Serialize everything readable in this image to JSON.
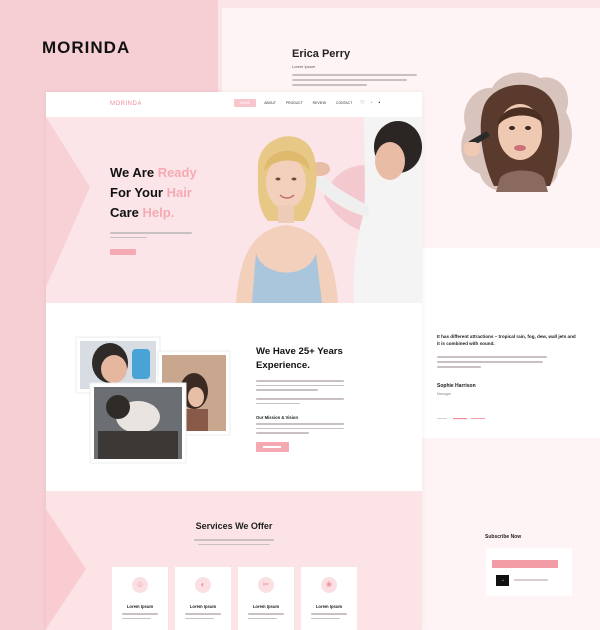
{
  "brand": "MORINDA",
  "nav": {
    "logo": "MORINDA",
    "items": [
      "HOME",
      "ABOUT",
      "PRODUCT",
      "REVIEW",
      "CONTACT"
    ],
    "active_index": 0,
    "icons": [
      "heart-icon",
      "user-icon",
      "cart-icon"
    ]
  },
  "hero": {
    "title_line1_plain": "We Are ",
    "title_line1_hl": "Ready",
    "title_line2_plain": "For Your ",
    "title_line2_hl": "Hair",
    "title_line3_plain": "Care ",
    "title_line3_hl": "Help."
  },
  "about": {
    "title": "We Have 25+ Years Experience.",
    "mission_heading": "Our Mission & Vision"
  },
  "services": {
    "title": "Services We Offer",
    "cards": [
      {
        "title": "Lorem Ipsum",
        "icon": "face-icon"
      },
      {
        "title": "Lorem Ipsum",
        "icon": "hairdryer-icon"
      },
      {
        "title": "Lorem Ipsum",
        "icon": "scissors-icon"
      },
      {
        "title": "Lorem Ipsum",
        "icon": "hair-icon"
      }
    ]
  },
  "testimonial_top": {
    "name": "Erica Perry",
    "role": "Lorem Ipsum"
  },
  "testimonial": {
    "quote": "It has different attractions – tropical rain, fog, dew, wall jets and it is combined with sound.",
    "author": "Sophie Harrison",
    "role": "Manager"
  },
  "subscribe": {
    "title": "Subscribe Now",
    "button_symbol": "→"
  },
  "colors": {
    "accent": "#f5aab3",
    "logo_pink": "#f08c98",
    "bg_pink": "#f6cfd4"
  }
}
